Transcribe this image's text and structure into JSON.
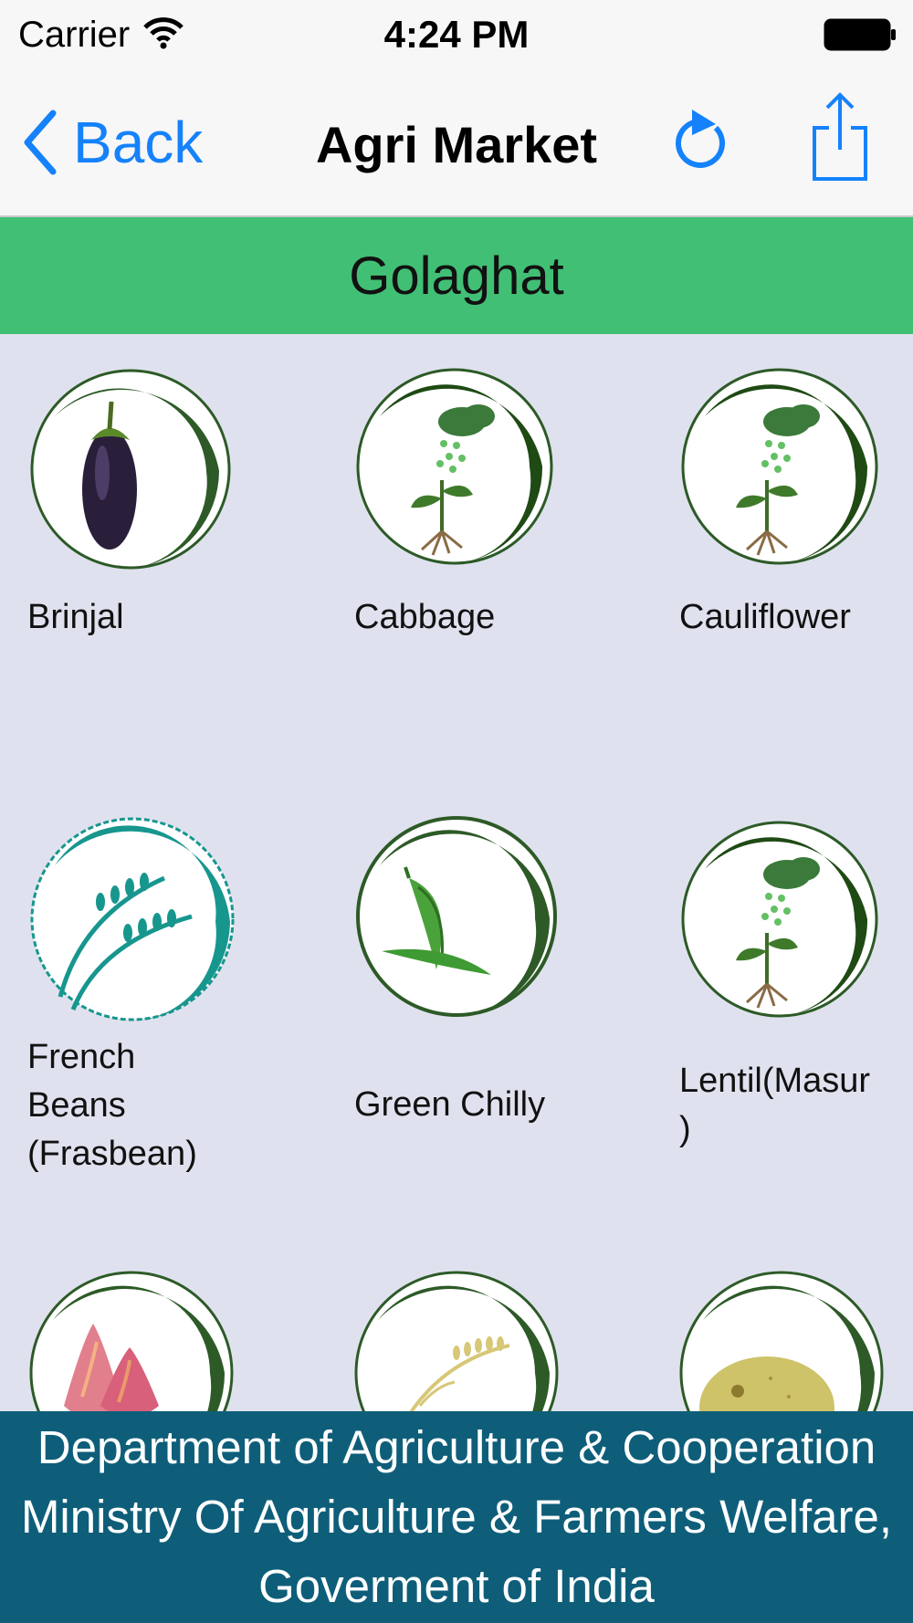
{
  "status_bar": {
    "carrier": "Carrier",
    "time": "4:24 PM"
  },
  "nav": {
    "back_label": "Back",
    "title": "Agri Market"
  },
  "region": {
    "name": "Golaghat"
  },
  "commodities": [
    {
      "label": "Brinjal",
      "icon": "brinjal-icon"
    },
    {
      "label": "Cabbage",
      "icon": "plant-rain-icon"
    },
    {
      "label": "Cauliflower",
      "icon": "plant-rain-icon"
    },
    {
      "label": "French\nBeans\n(Frasbean)",
      "icon": "wheat-icon"
    },
    {
      "label": "Green Chilly",
      "icon": "green-chilly-icon"
    },
    {
      "label": "Lentil(Masur\n)",
      "icon": "plant-rain-icon"
    },
    {
      "label": "",
      "icon": "onion-icon"
    },
    {
      "label": "",
      "icon": "paddy-icon"
    },
    {
      "label": "",
      "icon": "potato-icon"
    }
  ],
  "footer": {
    "line1": "Department of Agriculture & Cooperation",
    "line2": "Ministry Of Agriculture & Farmers Welfare,",
    "line3": "Goverment of India"
  },
  "colors": {
    "accent": "#1582fb",
    "region_bar": "#41c075",
    "footer_bg": "#0e5e7a",
    "grid_bg": "#dfe2ee",
    "ring_dark_green": "#2d5a27",
    "ring_teal": "#17968e"
  }
}
